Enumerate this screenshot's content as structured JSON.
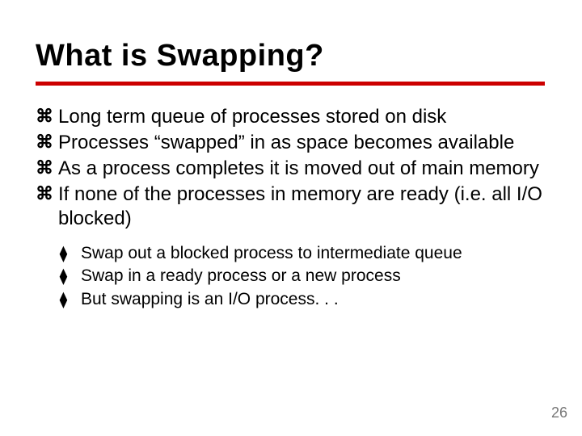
{
  "title": "What is Swapping?",
  "bullets": [
    "Long term queue of processes stored on disk",
    "Processes “swapped” in as space becomes available",
    "As a process completes it is moved out of main memory",
    "If none of the processes in memory are ready (i.e. all I/O blocked)"
  ],
  "subbullets": [
    "Swap out a blocked process to intermediate queue",
    "Swap in a ready process or a new process",
    "But swapping is an I/O process. . ."
  ],
  "glyphs": {
    "main": "⌘",
    "sub": "⧫"
  },
  "page_number": "26"
}
